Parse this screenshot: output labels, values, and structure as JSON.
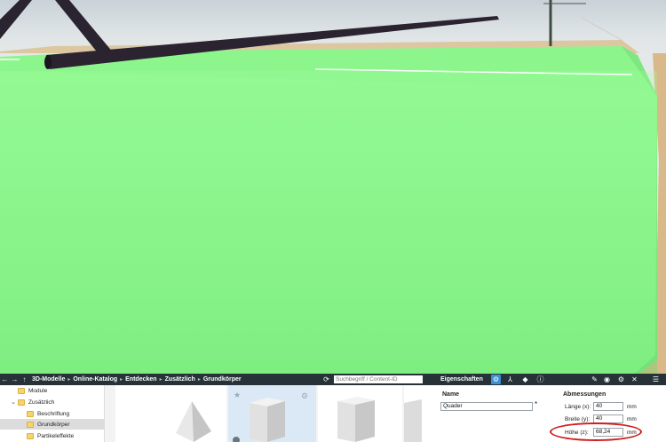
{
  "toolbar": {
    "back": "←",
    "forward": "→",
    "up": "↑",
    "breadcrumb": [
      "3D-Modelle",
      "Online-Katalog",
      "Entdecken",
      "Zusätzlich",
      "Grundkörper"
    ],
    "search_placeholder": "Suchbegriff / Content-ID",
    "properties_title": "Eigenschaften"
  },
  "tree": {
    "items": [
      {
        "label": "Module",
        "indent": 0,
        "twisty": ""
      },
      {
        "label": "Zusätzlich",
        "indent": 0,
        "twisty": "⌄"
      },
      {
        "label": "Beschriftung",
        "indent": 1,
        "twisty": ""
      },
      {
        "label": "Grundkörper",
        "indent": 1,
        "twisty": "",
        "selected": true
      },
      {
        "label": "Partikeleffekte",
        "indent": 1,
        "twisty": ""
      }
    ]
  },
  "properties": {
    "name_label": "Name",
    "name_value": "Quader",
    "name_marker": "*",
    "dimensions_label": "Abmessungen",
    "length_label": "Länge (x):",
    "length_value": "40",
    "width_label": "Breite (y):",
    "width_value": "40",
    "height_label": "Höhe (z):",
    "height_value": "68,24",
    "unit": "mm"
  },
  "colors": {
    "block_green": "#86f98a",
    "toolbar_bg": "#263238",
    "highlight": "#d01d1d"
  }
}
